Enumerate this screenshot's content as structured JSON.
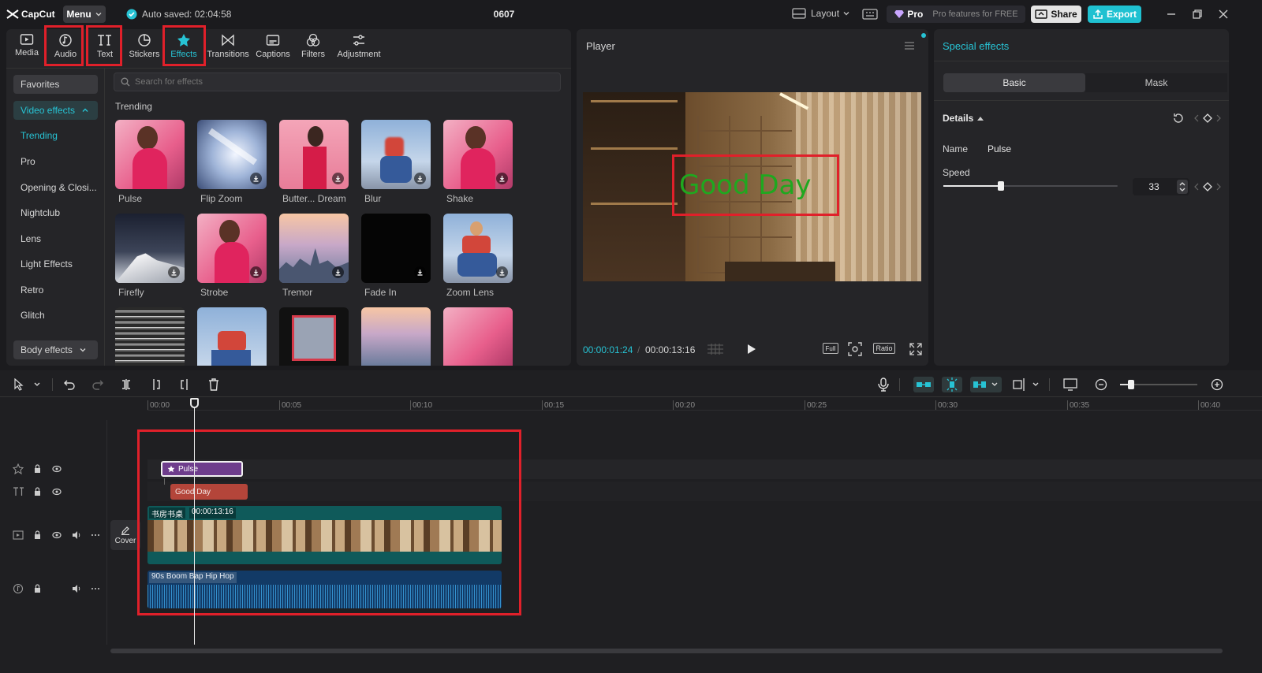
{
  "app": {
    "logo": "CapCut",
    "menu_label": "Menu",
    "autosave": "Auto saved: 02:04:58",
    "project_title": "0607",
    "layout_label": "Layout",
    "pro_label": "Pro",
    "pro_features": "Pro features for FREE",
    "share_label": "Share",
    "export_label": "Export"
  },
  "toolbar": {
    "tabs": [
      {
        "label": "Media",
        "icon": "media-icon"
      },
      {
        "label": "Audio",
        "icon": "audio-icon"
      },
      {
        "label": "Text",
        "icon": "text-icon"
      },
      {
        "label": "Stickers",
        "icon": "stickers-icon"
      },
      {
        "label": "Effects",
        "icon": "effects-icon",
        "active": true
      },
      {
        "label": "Transitions",
        "icon": "transitions-icon"
      },
      {
        "label": "Captions",
        "icon": "captions-icon"
      },
      {
        "label": "Filters",
        "icon": "filters-icon"
      },
      {
        "label": "Adjustment",
        "icon": "adjustment-icon"
      }
    ]
  },
  "effects_panel": {
    "search_placeholder": "Search for effects",
    "section_title": "Trending",
    "categories": {
      "favorites": "Favorites",
      "video_effects": "Video effects",
      "items": [
        "Trending",
        "Pro",
        "Opening & Closi...",
        "Nightclub",
        "Lens",
        "Light Effects",
        "Retro",
        "Glitch"
      ],
      "body_effects": "Body effects"
    },
    "effects": [
      "Pulse",
      "Flip Zoom",
      "Butter... Dream",
      "Blur",
      "Shake",
      "Firefly",
      "Strobe",
      "Tremor",
      "Fade In",
      "Zoom Lens"
    ]
  },
  "player": {
    "title": "Player",
    "overlay_text": "Good Day",
    "current_time": "00:00:01:24",
    "total_time": "00:00:13:16",
    "full_label": "Full",
    "ratio_label": "Ratio"
  },
  "inspector": {
    "title": "Special effects",
    "tabs": [
      "Basic",
      "Mask"
    ],
    "details_label": "Details",
    "name_label": "Name",
    "name_value": "Pulse",
    "speed_label": "Speed",
    "speed_value": "33",
    "speed_fraction": 0.33
  },
  "timeline": {
    "ticks": [
      "00:00",
      "00:05",
      "00:10",
      "00:15",
      "00:20",
      "00:25",
      "00:30",
      "00:35",
      "00:40"
    ],
    "effect_clip": "Pulse",
    "text_clip": "Good Day",
    "video_clip_name": "书房书桌",
    "video_clip_duration": "00:00:13:16",
    "cover_label": "Cover",
    "audio_clip": "90s Boom Bap Hip Hop"
  },
  "colors": {
    "accent": "#27c3d4",
    "highlight": "#e0202a",
    "effect_clip": "#6e3d8c",
    "text_clip": "#b4453a",
    "video_track": "#0f5a5a",
    "audio_track": "#123a66",
    "overlay_text": "#1fa81f"
  }
}
